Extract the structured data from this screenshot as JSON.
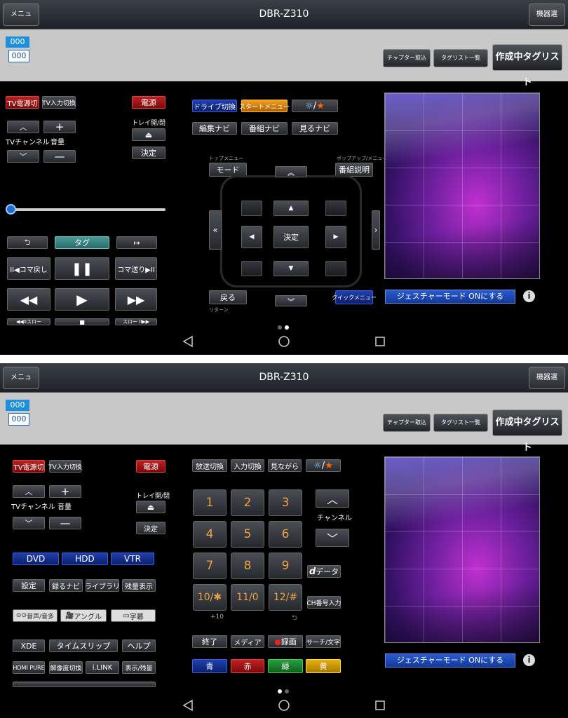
{
  "title": "DBR-Z310",
  "menu": "メニュー",
  "device_select": "機器選択",
  "channel_top": "000",
  "channel_bottom": "000",
  "chapter": "チャプター取込",
  "taglist": "タグリスト一覧",
  "making_tag": "作成中タグリスト",
  "left": {
    "tv_power": "TV電源切",
    "tv_input": "TV入力切換",
    "power": "電源",
    "tray": "トレイ開/閉",
    "enter": "決定",
    "tv_channel": "TVチャンネル",
    "volume": "音量"
  },
  "p1": {
    "drive": "ドライブ切換",
    "start_menu": "スタートメニュー",
    "edit_navi": "編集ナビ",
    "prog_navi": "番組ナビ",
    "watch_navi": "見るナビ",
    "top_menu": "トップメニュー",
    "mode": "モード",
    "popup_menu": "ポップアップ/メニュー",
    "prog_desc": "番組説明",
    "enter": "決定",
    "back": "戻る",
    "return": "リターン",
    "quick_menu": "クイックメニュー",
    "tag": "タグ",
    "skip_back": "II◀コマ戻し",
    "skip_fwd": "コマ送り▶II",
    "slow_back": "◀◀IIスロー",
    "slow_fwd": "スロー II▶▶"
  },
  "p2": {
    "broadcast": "放送切換",
    "input": "入力切換",
    "while_watch": "見ながら",
    "nums": [
      "1",
      "2",
      "3",
      "4",
      "5",
      "6",
      "7",
      "8",
      "9",
      "10/✱",
      "11/0",
      "12/#"
    ],
    "plus10": "+10",
    "channel": "チャンネル",
    "data": "データ",
    "ch_input": "CH番号入力",
    "dvd": "DVD",
    "hdd": "HDD",
    "vtr": "VTR",
    "settings": "設定",
    "rec_navi": "録るナビ",
    "library": "ライブラリ",
    "remain": "残量表示",
    "audio": "音声/音多",
    "angle": "アングル",
    "subtitle": "字幕",
    "xde": "XDE",
    "timeslip": "タイムスリップ",
    "help": "ヘルプ",
    "hdmi": "HDMI PURE",
    "resolution": "解像度切換",
    "ilink": "i.LINK",
    "disp_remain": "表示/残量",
    "end": "終了",
    "media": "メディア",
    "record": "録画",
    "search": "サーチ/文字",
    "blue": "青",
    "red": "赤",
    "green": "緑",
    "yellow": "黄"
  },
  "gesture_on": "ジェスチャーモード ONにする"
}
